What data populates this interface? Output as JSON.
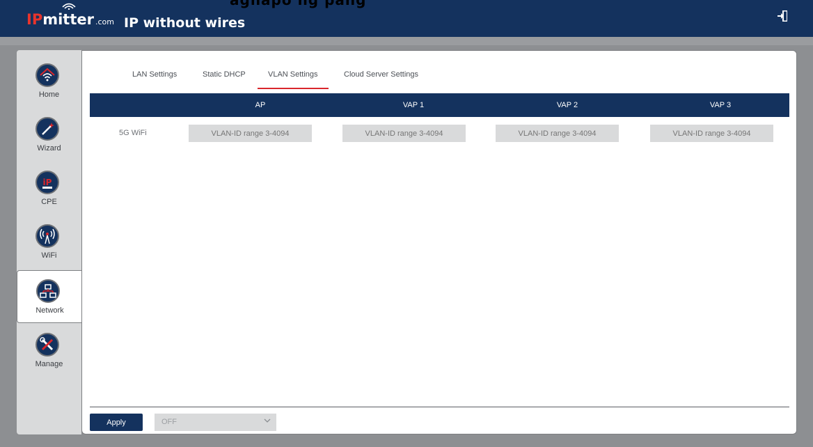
{
  "header": {
    "logo_ip": "IP",
    "logo_rest": "mitter",
    "logo_suffix": ".com",
    "tagline": "IP without wires",
    "cropped_text": "agnapo                    ng  pang"
  },
  "sidebar": {
    "items": [
      {
        "label": "Home",
        "icon": "home-wifi-icon"
      },
      {
        "label": "Wizard",
        "icon": "wizard-wand-icon"
      },
      {
        "label": "CPE",
        "icon": "ipmitter-cpe-icon"
      },
      {
        "label": "WiFi",
        "icon": "wifi-antenna-icon"
      },
      {
        "label": "Network",
        "icon": "network-icon"
      },
      {
        "label": "Manage",
        "icon": "manage-tools-icon"
      }
    ],
    "active": "Network"
  },
  "tabs": [
    {
      "label": "LAN Settings"
    },
    {
      "label": "Static DHCP"
    },
    {
      "label": "VLAN Settings"
    },
    {
      "label": "Cloud Server Settings"
    }
  ],
  "active_tab": "VLAN Settings",
  "table": {
    "columns": [
      "AP",
      "VAP 1",
      "VAP 2",
      "VAP 3"
    ],
    "rows": [
      {
        "label": "5G WiFi",
        "placeholders": [
          "VLAN-ID range 3-4094",
          "VLAN-ID range 3-4094",
          "VLAN-ID range 3-4094",
          "VLAN-ID range 3-4094"
        ]
      }
    ]
  },
  "footer": {
    "apply_label": "Apply",
    "select_value": "OFF"
  },
  "colors": {
    "navy": "#14325e",
    "accent_red": "#d9262c",
    "backdrop": "#8d8f92",
    "sidebar": "#d9dadb"
  }
}
